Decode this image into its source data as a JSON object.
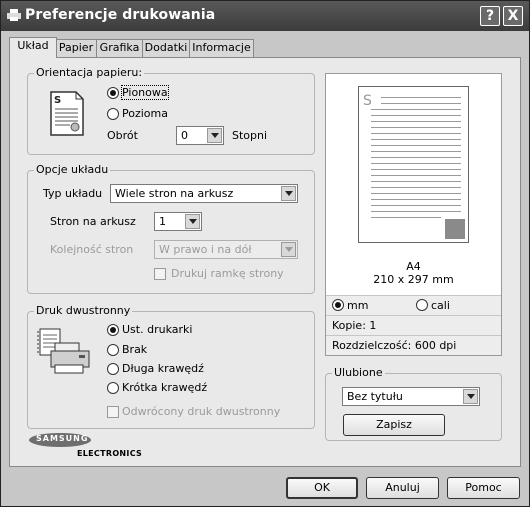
{
  "window": {
    "title": "Preferencje drukowania",
    "help_btn": "?",
    "close_btn": "X"
  },
  "tabs": [
    "Układ",
    "Papier",
    "Grafika",
    "Dodatki",
    "Informacje"
  ],
  "orientation": {
    "group_label": "Orientacja papieru:",
    "portrait": "Pionowa",
    "landscape": "Pozioma",
    "rotation_label": "Obrót",
    "rotation_value": "0",
    "rotation_unit": "Stopni",
    "icon_letter": "S",
    "selected": "portrait"
  },
  "layout": {
    "group_label": "Opcje układu",
    "type_label": "Typ układu",
    "type_value": "Wiele stron na arkusz",
    "pages_label": "Stron na arkusz",
    "pages_value": "1",
    "order_label": "Kolejność stron",
    "order_value": "W prawo i na dół",
    "border_label": "Drukuj ramkę strony"
  },
  "duplex": {
    "group_label": "Druk dwustronny",
    "options": [
      "Ust. drukarki",
      "Brak",
      "Długa krawędź",
      "Krótka krawędź"
    ],
    "selected_index": 0,
    "reverse_label": "Odwrócony druk dwustronny"
  },
  "logo": {
    "brand": "SAMSUNG",
    "sub": "ELECTRONICS"
  },
  "preview": {
    "page_letter": "S",
    "paper": "A4",
    "size": "210 x 297 mm",
    "unit_mm": "mm",
    "unit_inch": "cali",
    "copies": "Kopie: 1",
    "resolution": "Rozdzielczość: 600 dpi"
  },
  "favorites": {
    "group_label": "Ulubione",
    "value": "Bez tytułu",
    "save_label": "Zapisz"
  },
  "footer": {
    "ok": "OK",
    "cancel": "Anuluj",
    "help": "Pomoc"
  }
}
